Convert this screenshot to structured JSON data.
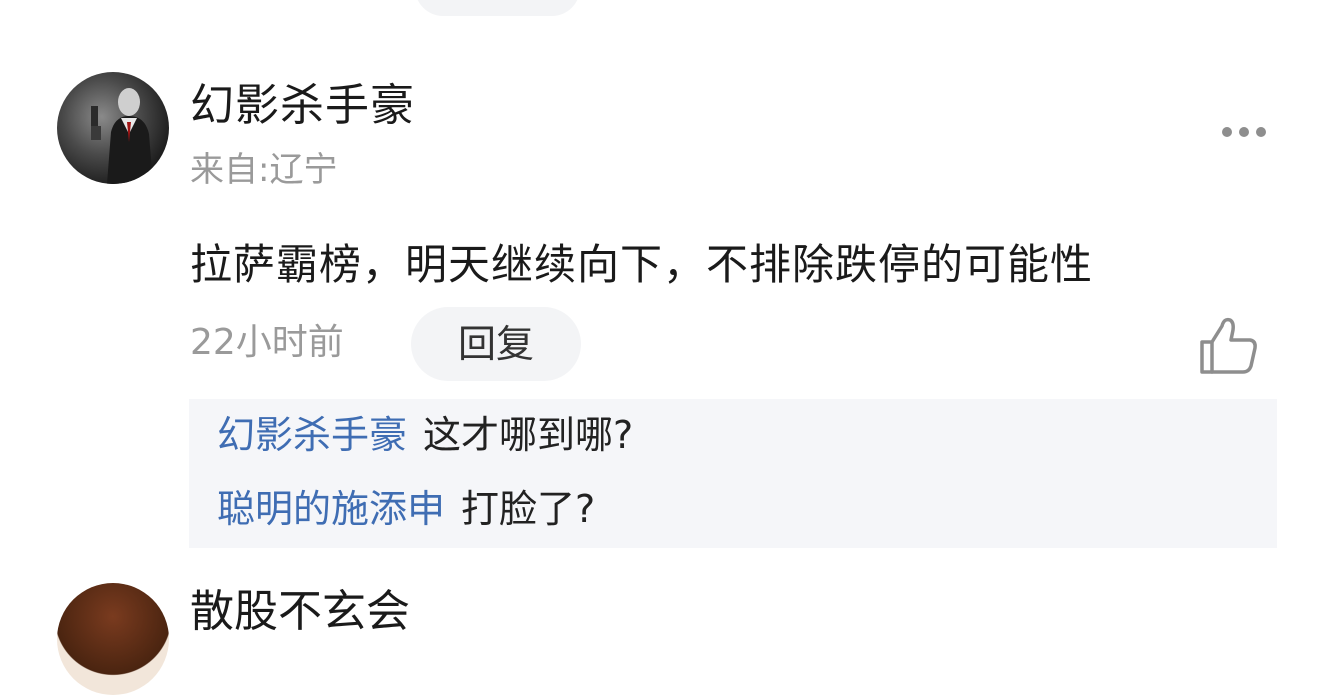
{
  "comment": {
    "username": "幻影杀手豪",
    "location": "来自:辽宁",
    "text": "拉萨霸榜，明天继续向下，不排除跌停的可能性",
    "timestamp": "22小时前",
    "reply_label": "回复",
    "icons": {
      "more": "more-icon",
      "like": "thumbs-up-icon"
    }
  },
  "replies": [
    {
      "author": "幻影杀手豪",
      "text": "这才哪到哪?"
    },
    {
      "author": "聪明的施添申",
      "text": "打脸了?"
    }
  ],
  "next_comment": {
    "username": "散股不玄会"
  },
  "colors": {
    "username": "#1a1a1a",
    "meta": "#9a9a9a",
    "reply_author": "#3f6db3",
    "reply_box_bg": "#f5f6f9",
    "pill_bg": "#f3f4f6"
  }
}
